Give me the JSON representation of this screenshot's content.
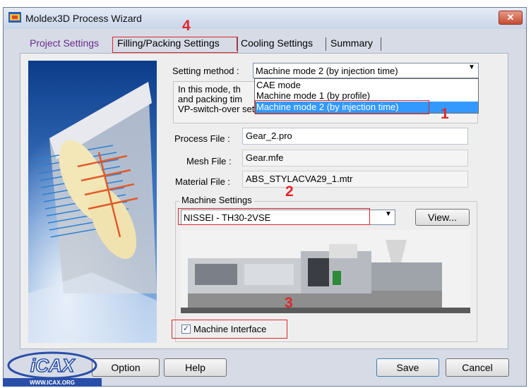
{
  "window": {
    "title": "Moldex3D Process Wizard",
    "close_label": "✕"
  },
  "tabs": [
    {
      "label": "Project Settings",
      "active": true
    },
    {
      "label": "Filling/Packing Settings",
      "active": false
    },
    {
      "label": "Cooling Settings",
      "active": false
    },
    {
      "label": "Summary",
      "active": false
    }
  ],
  "setting_method": {
    "label": "Setting method :",
    "value": "Machine mode 2 (by injection time)",
    "description": [
      "In this mode, th",
      "and packing tim",
      "VP-switch-over settings."
    ],
    "options": [
      "CAE mode",
      "Machine mode 1 (by profile)",
      "Machine mode 2 (by injection time)"
    ]
  },
  "files": {
    "process_label": "Process File :",
    "process_value": "Gear_2.pro",
    "mesh_label": "Mesh File :",
    "mesh_value": "Gear.mfe",
    "material_label": "Material File :",
    "material_value": "ABS_STYLACVA29_1.mtr"
  },
  "machine": {
    "group_label": "Machine Settings",
    "selected": "NISSEI - TH30-2VSE",
    "view_button": "View...",
    "interface_label": "Machine Interface",
    "interface_checked": true
  },
  "footer": {
    "option": "Option",
    "help": "Help",
    "save": "Save",
    "cancel": "Cancel"
  },
  "annotations": [
    "1",
    "2",
    "3",
    "4"
  ],
  "logo": {
    "text": "WWW.ICAX.ORG"
  },
  "colors": {
    "accent": "#e0262a",
    "selection": "#3399ff",
    "active_tab": "#6a2b8f"
  }
}
